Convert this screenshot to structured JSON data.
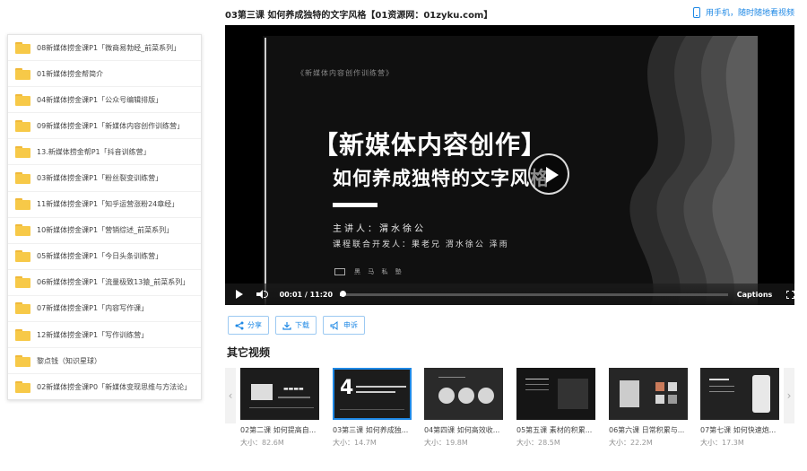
{
  "header": {
    "title": "03第三课 如何养成独特的文字风格【01资源网：01zyku.com】",
    "mobile_link": "用手机，随时随地看视频"
  },
  "sidebar": {
    "items": [
      {
        "label": "08新媒体捞金课P1「微商易勃经_前菜系列」"
      },
      {
        "label": "01新媒体捞金帮简介"
      },
      {
        "label": "04新媒体捞金课P1「公众号编辑排版」"
      },
      {
        "label": "09新媒体捞金课P1「新媒体内容创作训练营」"
      },
      {
        "label": "13.新媒体捞金帮P1「抖音训练营」"
      },
      {
        "label": "03新媒体捞金课P1「粉丝裂变训练营」"
      },
      {
        "label": "11新媒体捞金课P1「知乎运营涨粉24章经」"
      },
      {
        "label": "10新媒体捞金课P1「营销综述_前菜系列」"
      },
      {
        "label": "05新媒体捞金课P1「今日头条训练营」"
      },
      {
        "label": "06新媒体捞金课P1「流量极致13猿_前菜系列」"
      },
      {
        "label": "07新媒体捞金课P1「内容写作课」"
      },
      {
        "label": "12新媒体捞金课P1「写作训练营」"
      },
      {
        "label": "黎点钱（知识星球）"
      },
      {
        "label": "02新媒体捞金课P0「新媒体变现思维与方法论」"
      }
    ]
  },
  "video": {
    "slide": {
      "top_text": "《新媒体内容创作训练营》",
      "title1": "【新媒体内容创作】",
      "title2": "如何养成独特的文字风格",
      "speaker": "主讲人：渭水徐公",
      "developers": "课程联合开发人：果老兄  渭水徐公  泽雨",
      "logo_text": "黑 马 私 塾"
    },
    "current_time": "00:01",
    "duration": "11:20",
    "progress": 0.0015,
    "captions_label": "Captions"
  },
  "actions": {
    "share": "分享",
    "download": "下载",
    "report": "申诉"
  },
  "other_videos": {
    "title": "其它视频",
    "size_prefix": "大小：",
    "items": [
      {
        "name": "02第二课 如何提高自...",
        "size": "82.6M",
        "active": false
      },
      {
        "name": "03第三课 如何养成独...",
        "size": "14.7M",
        "active": true
      },
      {
        "name": "04第四课 如何高效收...",
        "size": "19.8M",
        "active": false
      },
      {
        "name": "05第五课 素材的积累...",
        "size": "28.5M",
        "active": false
      },
      {
        "name": "06第六课 日常积累与...",
        "size": "22.2M",
        "active": false
      },
      {
        "name": "07第七课 如何快速炮...",
        "size": "17.3M",
        "active": false
      }
    ]
  },
  "colors": {
    "accent": "#1e88e5",
    "folder": "#f7c948"
  }
}
